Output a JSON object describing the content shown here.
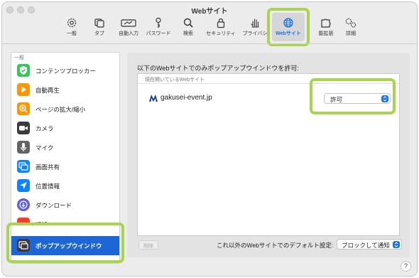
{
  "window": {
    "title": "Webサイト"
  },
  "toolbar": {
    "items": [
      {
        "label": "一般",
        "icon": "gear-icon"
      },
      {
        "label": "タブ",
        "icon": "tabs-icon"
      },
      {
        "label": "自動入力",
        "icon": "autofill-icon"
      },
      {
        "label": "パスワード",
        "icon": "key-icon"
      },
      {
        "label": "検索",
        "icon": "search-icon"
      },
      {
        "label": "セキュリティ",
        "icon": "lock-icon"
      },
      {
        "label": "プライバシ",
        "icon": "hand-icon"
      },
      {
        "label": "Webサイト",
        "icon": "globe-icon",
        "active": true
      },
      {
        "label": "能拡張",
        "icon": "puzzle-icon"
      },
      {
        "label": "詳細",
        "icon": "gears-icon"
      }
    ]
  },
  "sidebar": {
    "header": "一般",
    "items": [
      {
        "label": "コンテンツブロッカー",
        "icon": "shield-check-icon",
        "color": "#34c759"
      },
      {
        "label": "自動再生",
        "icon": "play-icon",
        "color": "#ff9500"
      },
      {
        "label": "ページの拡大/縮小",
        "icon": "zoom-icon",
        "color": "#ff9500"
      },
      {
        "label": "カメラ",
        "icon": "camera-icon",
        "color": "#3a3a3c"
      },
      {
        "label": "マイク",
        "icon": "microphone-icon",
        "color": "#636366"
      },
      {
        "label": "画面共有",
        "icon": "screen-share-icon",
        "color": "#0a84ff"
      },
      {
        "label": "位置情報",
        "icon": "location-icon",
        "color": "#0a84ff"
      },
      {
        "label": "ダウンロード",
        "icon": "download-icon",
        "color": "#5e5ce6"
      },
      {
        "label": "通知",
        "icon": "notification-icon",
        "color": "#ff3b30"
      },
      {
        "label": "ポップアップウインドウ",
        "icon": "popup-window-icon",
        "color": "#3a3a3c",
        "selected": true
      }
    ]
  },
  "main": {
    "title": "以下のWebサイトでのみポップアップウインドウを許可:",
    "list_header": "現在開いているWebサイト",
    "site": {
      "name": "gakusei-event.jp",
      "setting": "許可"
    },
    "delete_label": "削除",
    "default_label": "これ以外のWebサイトでのデフォルト設定:",
    "default_value": "ブロックして通知"
  },
  "help_label": "?",
  "colors": {
    "accent": "#1a73e8",
    "highlight": "#a9d54e",
    "selection": "#1c66d6"
  }
}
